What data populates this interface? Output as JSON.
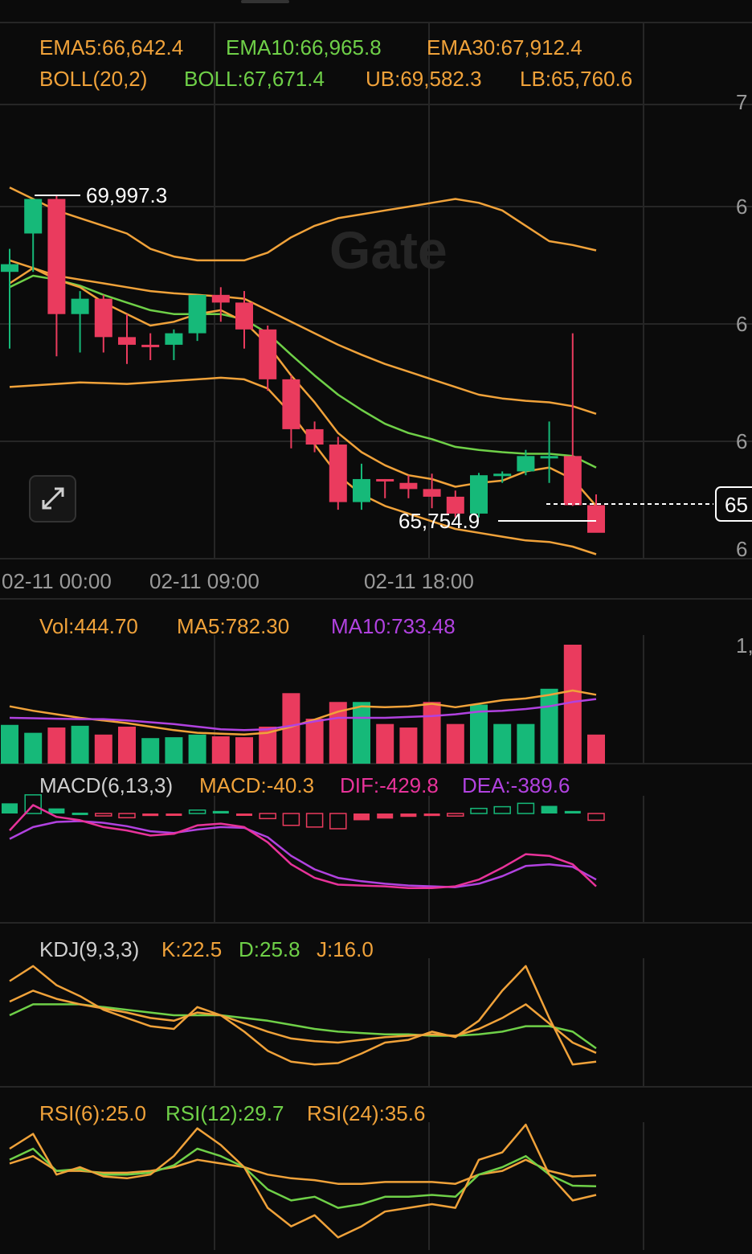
{
  "colors": {
    "bg": "#0b0b0b",
    "up": "#16b979",
    "down": "#ea3b5e",
    "orange": "#f0a23a",
    "green": "#6fd048",
    "purple": "#b142e0",
    "pink": "#e8339a",
    "grid": "#262626",
    "text": "#dddddd",
    "muted": "#9a9a9a"
  },
  "icons": {
    "expand": "expand-arrows-icon"
  },
  "watermark": "Gate",
  "main_legend": {
    "ema5": "EMA5:66,642.4",
    "ema10": "EMA10:66,965.8",
    "ema30": "EMA30:67,912.4",
    "boll_params": "BOLL(20,2)",
    "boll_mid": "BOLL:67,671.4",
    "boll_ub": "UB:69,582.3",
    "boll_lb": "LB:65,760.6"
  },
  "right_axis_labels": [
    "7",
    "6",
    "6",
    "6",
    "6"
  ],
  "last_price_label": "65",
  "x_labels": [
    "02-11 00:00",
    "02-11 09:00",
    "02-11 18:00"
  ],
  "volume_legend": {
    "vol": "Vol:444.70",
    "ma5": "MA5:782.30",
    "ma10": "MA10:733.48"
  },
  "volume_axis_label": "1,",
  "macd_legend": {
    "params": "MACD(6,13,3)",
    "macd": "MACD:-40.3",
    "dif": "DIF:-429.8",
    "dea": "DEA:-389.6"
  },
  "kdj_legend": {
    "params": "KDJ(9,3,3)",
    "k": "K:22.5",
    "d": "D:25.8",
    "j": "J:16.0"
  },
  "rsi_legend": {
    "rsi6": "RSI(6):25.0",
    "rsi12": "RSI(12):29.7",
    "rsi24": "RSI(24):35.6"
  },
  "chart_data": {
    "type": "candlestick",
    "high_marker": "69,997.3",
    "low_marker": "65,754.9",
    "candles": [
      {
        "o": 69000,
        "h": 69300,
        "l": 68000,
        "c": 69100
      },
      {
        "o": 69500,
        "h": 69950,
        "l": 69000,
        "c": 69950
      },
      {
        "o": 69950,
        "h": 69997.3,
        "l": 67900,
        "c": 68450
      },
      {
        "o": 68450,
        "h": 68750,
        "l": 67950,
        "c": 68650
      },
      {
        "o": 68650,
        "h": 68700,
        "l": 67950,
        "c": 68150
      },
      {
        "o": 68150,
        "h": 68450,
        "l": 67800,
        "c": 68050
      },
      {
        "o": 68050,
        "h": 68200,
        "l": 67850,
        "c": 68030
      },
      {
        "o": 68050,
        "h": 68250,
        "l": 67850,
        "c": 68200
      },
      {
        "o": 68200,
        "h": 68700,
        "l": 68100,
        "c": 68700
      },
      {
        "o": 68700,
        "h": 68800,
        "l": 68350,
        "c": 68600
      },
      {
        "o": 68600,
        "h": 68750,
        "l": 68000,
        "c": 68250
      },
      {
        "o": 68250,
        "h": 68300,
        "l": 67450,
        "c": 67600
      },
      {
        "o": 67600,
        "h": 67650,
        "l": 66700,
        "c": 66950
      },
      {
        "o": 66950,
        "h": 67050,
        "l": 66650,
        "c": 66750
      },
      {
        "o": 66750,
        "h": 66850,
        "l": 65900,
        "c": 66000
      },
      {
        "o": 66000,
        "h": 66500,
        "l": 65900,
        "c": 66300
      },
      {
        "o": 66300,
        "h": 66300,
        "l": 66050,
        "c": 66270
      },
      {
        "o": 66250,
        "h": 66350,
        "l": 66050,
        "c": 66170
      },
      {
        "o": 66170,
        "h": 66370,
        "l": 65920,
        "c": 66070
      },
      {
        "o": 66070,
        "h": 66150,
        "l": 65800,
        "c": 65850
      },
      {
        "o": 65850,
        "h": 66380,
        "l": 65800,
        "c": 66350
      },
      {
        "o": 66350,
        "h": 66400,
        "l": 66250,
        "c": 66370
      },
      {
        "o": 66400,
        "h": 66680,
        "l": 66350,
        "c": 66600
      },
      {
        "o": 66600,
        "h": 67050,
        "l": 66250,
        "c": 66600
      },
      {
        "o": 66600,
        "h": 68200,
        "l": 65950,
        "c": 65960
      },
      {
        "o": 65960,
        "h": 66100,
        "l": 65754.9,
        "c": 65600
      }
    ],
    "ema5": [
      68850,
      69050,
      68900,
      68800,
      68600,
      68450,
      68300,
      68350,
      68450,
      68500,
      68350,
      68050,
      67650,
      67300,
      66900,
      66650,
      66480,
      66350,
      66300,
      66200,
      66250,
      66280,
      66400,
      66450,
      66300,
      65950
    ],
    "ema10": [
      68800,
      68950,
      68900,
      68820,
      68700,
      68600,
      68500,
      68450,
      68450,
      68450,
      68380,
      68200,
      67920,
      67650,
      67400,
      67200,
      67020,
      66900,
      66820,
      66720,
      66680,
      66650,
      66630,
      66630,
      66600,
      66450
    ],
    "ema30": [
      69150,
      69050,
      68950,
      68900,
      68850,
      68800,
      68750,
      68720,
      68700,
      68680,
      68650,
      68500,
      68350,
      68200,
      68050,
      67920,
      67800,
      67700,
      67600,
      67500,
      67400,
      67350,
      67320,
      67300,
      67250,
      67150
    ],
    "boll_ub": [
      70100,
      69950,
      69800,
      69700,
      69600,
      69500,
      69300,
      69200,
      69150,
      69150,
      69150,
      69250,
      69450,
      69600,
      69700,
      69750,
      69800,
      69850,
      69900,
      69950,
      69900,
      69800,
      69600,
      69400,
      69350,
      69280
    ],
    "boll_lb": [
      67500,
      67520,
      67540,
      67560,
      67550,
      67540,
      67560,
      67580,
      67600,
      67620,
      67600,
      67480,
      67150,
      66750,
      66350,
      66100,
      65950,
      65850,
      65750,
      65650,
      65600,
      65550,
      65500,
      65480,
      65420,
      65320
    ],
    "volume": [
      440,
      350,
      410,
      430,
      330,
      420,
      290,
      300,
      330,
      310,
      300,
      420,
      800,
      510,
      700,
      700,
      450,
      410,
      700,
      450,
      670,
      450,
      450,
      850,
      1350,
      330
    ],
    "vol_up": [
      true,
      true,
      false,
      true,
      false,
      false,
      true,
      true,
      true,
      false,
      false,
      false,
      false,
      false,
      false,
      true,
      false,
      false,
      false,
      false,
      true,
      true,
      true,
      true,
      false,
      false
    ],
    "vol_ma5": [
      650,
      600,
      560,
      520,
      490,
      460,
      420,
      380,
      350,
      340,
      330,
      350,
      420,
      500,
      590,
      650,
      640,
      650,
      680,
      640,
      680,
      720,
      740,
      780,
      830,
      782
    ],
    "vol_ma10": [
      520,
      515,
      510,
      505,
      505,
      490,
      470,
      450,
      420,
      390,
      380,
      390,
      430,
      480,
      520,
      520,
      520,
      530,
      540,
      560,
      590,
      600,
      620,
      650,
      700,
      733
    ],
    "macd_hist": [
      60,
      110,
      30,
      5,
      -10,
      -25,
      -15,
      -5,
      20,
      15,
      -10,
      -30,
      -70,
      -80,
      -90,
      -40,
      -30,
      -20,
      -15,
      -15,
      30,
      40,
      60,
      45,
      15,
      -40
    ],
    "dif": [
      -100,
      50,
      -20,
      -40,
      -80,
      -100,
      -130,
      -120,
      -70,
      -60,
      -80,
      -170,
      -300,
      -380,
      -420,
      -425,
      -430,
      -440,
      -440,
      -430,
      -390,
      -320,
      -240,
      -250,
      -300,
      -430
    ],
    "dea": [
      -150,
      -80,
      -50,
      -45,
      -55,
      -75,
      -105,
      -115,
      -95,
      -80,
      -85,
      -140,
      -250,
      -330,
      -380,
      -400,
      -415,
      -425,
      -430,
      -435,
      -415,
      -370,
      -310,
      -300,
      -315,
      -390
    ],
    "kdj_k": [
      60,
      68,
      62,
      58,
      55,
      52,
      48,
      46,
      52,
      50,
      44,
      38,
      33,
      31,
      30,
      32,
      34,
      35,
      36,
      35,
      40,
      48,
      58,
      44,
      30,
      22.5
    ],
    "kdj_d": [
      50,
      58,
      58,
      58,
      56,
      54,
      52,
      50,
      50,
      50,
      48,
      46,
      43,
      40,
      38,
      37,
      36,
      36,
      35,
      35,
      36,
      38,
      42,
      42,
      38,
      25.8
    ],
    "kdj_j": [
      75,
      86,
      72,
      64,
      54,
      48,
      42,
      40,
      56,
      50,
      38,
      24,
      16,
      14,
      15,
      22,
      30,
      32,
      38,
      34,
      46,
      68,
      86,
      48,
      14,
      16.0
    ],
    "rsi6": [
      50,
      58,
      36,
      40,
      35,
      34,
      36,
      46,
      61,
      52,
      40,
      18,
      8,
      14,
      2,
      8,
      16,
      18,
      20,
      18,
      44,
      48,
      63,
      36,
      22,
      25.0
    ],
    "rsi12": [
      44,
      50,
      38,
      39,
      36,
      36,
      37,
      41,
      50,
      46,
      40,
      28,
      22,
      24,
      18,
      20,
      24,
      24,
      25,
      24,
      36,
      40,
      46,
      36,
      30,
      29.7
    ],
    "rsi24": [
      42,
      46,
      38,
      38,
      37,
      37,
      38,
      40,
      44,
      42,
      40,
      36,
      34,
      33,
      31,
      31,
      32,
      32,
      32,
      31,
      36,
      38,
      44,
      38,
      35,
      35.6
    ]
  }
}
